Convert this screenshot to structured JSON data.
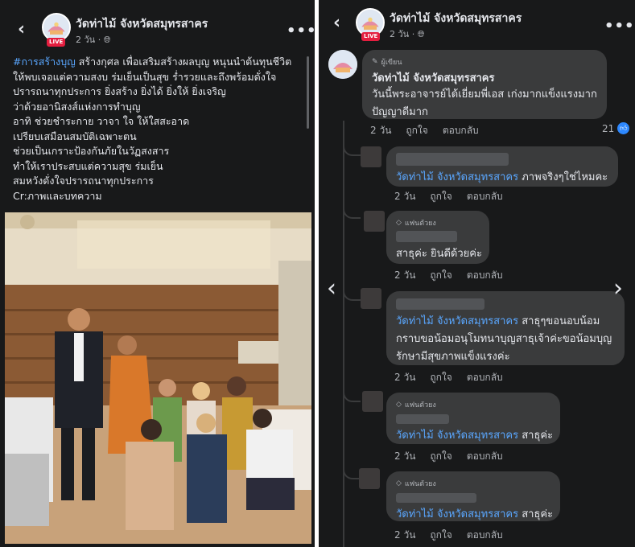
{
  "left": {
    "page_name": "วัดท่าไม้ จังหวัดสมุทรสาคร",
    "live_label": "LIVE",
    "time": "2 วัน ·",
    "privacy_icon": "globe-icon",
    "more_label": "•••",
    "hashtag": "#การสร้างบุญ",
    "lines": [
      " สร้างกุศล เพื่อเสริมสร้างผลบุญ หนุนนำต้นทุนชีวิต",
      "ให้พบเจอแต่ความสงบ ร่มเย็นเป็นสุข ร่ำรวยและถึงพร้อมดั่งใจ",
      "ปรารถนาทุกประการ ยิ่งสร้าง ยิ่งได้ ยิ่งให้ ยิ่งเจริญ",
      "ว่าด้วยอานิสงส์แห่งการทำบุญ",
      "อาทิ ช่วยชำระกาย วาจา ใจ ให้ใสสะอาด",
      "เปรียบเสมือนสมบัติเฉพาะตน",
      "ช่วยเป็นเกราะป้องกันภัยในวัฏสงสาร",
      "ทำให้เราประสบแต่ความสุข ร่มเย็น",
      "สมหวังดั่งใจปรารถนาทุกประการ",
      "Cr:ภาพและบทความ"
    ]
  },
  "right": {
    "page_name": "วัดท่าไม้ จังหวัดสมุทรสาคร",
    "live_label": "LIVE",
    "time": "2 วัน ·",
    "more_label": "•••",
    "prev_label": "‹",
    "next_label": "›",
    "comments": [
      {
        "badge": "ผู้เขียน",
        "author": "วัดท่าไม้ จังหวัดสมุทรสาคร",
        "lines": [
          "วันนี้พระอาจารย์ได้เยี่ยมพี่เอส เก่งมากแข็งแรงมาก",
          "ปัญญาดีมาก"
        ],
        "time": "2 วัน",
        "like": "ถูกใจ",
        "reply": "ตอบกลับ",
        "reactions": "21"
      },
      {
        "tag": "วัดท่าไม้ จังหวัดสมุทรสาคร",
        "text": " ภาพจริงๆใช่ไหมคะ",
        "time": "2 วัน",
        "like": "ถูกใจ",
        "reply": "ตอบกลับ"
      },
      {
        "badge": "แฟนตัวยง",
        "text": "สาธุค่ะ ยินดีด้วยค่ะ",
        "time": "2 วัน",
        "like": "ถูกใจ",
        "reply": "ตอบกลับ"
      },
      {
        "tag": "วัดท่าไม้ จังหวัดสมุทรสาคร",
        "lines": [
          " สาธุๆขอนอบน้อม",
          "กราบขอน้อมอนุโมทนาบุญสาธุเจ้าค่ะขอน้อมบุญ",
          "รักษามีสุขภาพแข็งแรงค่ะ"
        ],
        "time": "2 วัน",
        "like": "ถูกใจ",
        "reply": "ตอบกลับ"
      },
      {
        "badge": "แฟนตัวยง",
        "tag": "วัดท่าไม้ จังหวัดสมุทรสาคร",
        "text": " สาธุค่ะ",
        "time": "2 วัน",
        "like": "ถูกใจ",
        "reply": "ตอบกลับ"
      },
      {
        "badge": "แฟนตัวยง",
        "tag": "วัดท่าไม้ จังหวัดสมุทรสาคร",
        "text": " สาธุค่ะ",
        "time": "2 วัน",
        "like": "ถูกใจ",
        "reply": "ตอบกลับ"
      }
    ]
  },
  "colors": {
    "background": "#18191a",
    "bubble": "#3a3b3c",
    "text": "#e4e6eb",
    "muted": "#b0b3b8",
    "link": "#5aa7ff",
    "live": "#e41e3f",
    "like": "#2d88ff"
  }
}
